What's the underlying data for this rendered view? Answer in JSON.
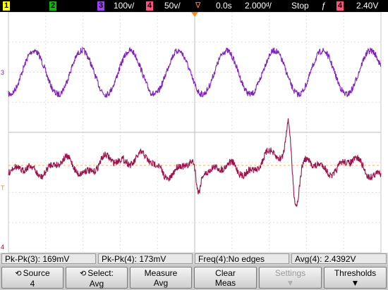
{
  "statusbar": {
    "ch1": "1",
    "ch2": "2",
    "ch3": "3",
    "ch3_scale": "100ᴠ/",
    "ch4": "4",
    "ch4_scale": "50ᴠ/",
    "time_delay": "0.0s",
    "time_base": "2.000ᵈ/",
    "run_state": "Stop",
    "trigger_slope_icon": "rising-edge",
    "trigger_source": "4",
    "trigger_level": "2.40V"
  },
  "markers": {
    "ch3_marker": "3",
    "trig_marker": "T",
    "ch4_marker": "4"
  },
  "colors": {
    "ch3": "#8020c0",
    "ch4": "#a0104a",
    "ch1_box": "#ffff00",
    "ch2_box": "#00c000",
    "ch3_box": "#a040ff",
    "ch4_box": "#ff5080",
    "trigger": "#ff8c00"
  },
  "measurements": [
    {
      "label": "Pk-Pk(3): 169mV"
    },
    {
      "label": "Pk-Pk(4): 173mV"
    },
    {
      "label": "Freq(4):No edges"
    },
    {
      "label": "Avg(4): 2.4392V"
    }
  ],
  "softkeys": {
    "source": {
      "line1": "Source",
      "line2": "4"
    },
    "select": {
      "line1": "Select:",
      "line2": "Avg"
    },
    "measure": {
      "line1": "Measure",
      "line2": "Avg"
    },
    "clear": {
      "line1": "Clear",
      "line2": "Meas"
    },
    "settings": {
      "line1": "Settings",
      "line2": ""
    },
    "thresholds": {
      "line1": "Thresholds",
      "line2": ""
    }
  }
}
